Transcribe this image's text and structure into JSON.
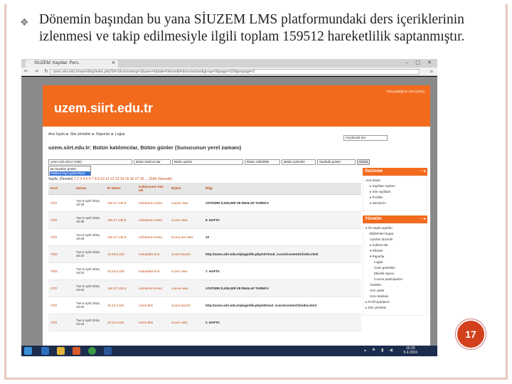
{
  "slide": {
    "bullet_icon": "diamond-bullet",
    "text": "Dönemin başından bu yana SİUZEM LMS platformundaki ders içeriklerinin izlenmesi ve takip edilmesiyle ilgili toplam 159512 hareketlilik saptanmıştır.",
    "page_number": "17"
  },
  "browser": {
    "tab_title": "SİUZEM: Kayıtlar: Pers..",
    "url": "uzem.siirt.edu.tr/report/log/index.php?id=1&chooselog=1&user=0&date=0&modid=&modaction&group=0&page=100&perpage=3",
    "nav_glyphs": "← → ↻",
    "window_controls": "– □ ✕"
  },
  "site": {
    "title": "uzem.siirt.edu.tr",
    "login_info": "Giriş yaptığınız isim (Çıkış)",
    "breadcrumb": "Ana Sayfa ► Site yönetimi ► Raporlar ► Loglar",
    "search_placeholder": "Kayıtlarda ara",
    "heading": "uzem.siirt.edu.tr: Bütün katılımcılar, Bütün günler (Sunucunun yerel zamanı)",
    "filters": {
      "course": "uzem.siirt.edu.tr (Site)",
      "participants": "Bütün katılımcılar",
      "day": "Bütün günler",
      "activities": "Bütün etkinlikler",
      "actions": "Bütün eylemler",
      "display": "Sayfada göster",
      "submit": "Gözat"
    },
    "dropdown_options": [
      "Bu kayıtları göster",
      "159512 kayıt gösteriliyor"
    ],
    "pager": {
      "prefix": "Sayfa: (Önceki)",
      "pages": "1 2 3 4 5 6 7 8 9 10 11 12 13 14 15 16 17 18 ... 1596",
      "next": "(Sonraki)"
    },
    "table": {
      "headers": [
        "Kurs",
        "Zaman",
        "IP adresi",
        "Kullanıcının tam adı",
        "Eylem",
        "Bilgi"
      ],
      "rows": [
        [
          "ATİ2",
          "Tue 5 April 2016, 15:35",
          "194.27.145.9",
          "muharrem ersan",
          "course view",
          "ATATÜRK İLKELERİ VE İNKILAP TARİHİ II"
        ],
        [
          "ATİ2",
          "Tue 5 April 2016, 15:35",
          "194.27.145.9",
          "muharrem ersan",
          "scorm view",
          "9. HAFTA"
        ],
        [
          "ATİ2",
          "Tue 5 April 2016, 15:35",
          "194.27.145.9",
          "muharrem ersan",
          "scorm pre-view",
          "10"
        ],
        [
          "TDİ2",
          "Tue 5 April 2016, 15:34",
          "10.45.0.220",
          "mukaddes kurt",
          "scorm launch",
          "http://uzem.siirt.edu.tr/pluginfile.php/157/mod_scorm/content/1/index.html"
        ],
        [
          "TDİ2",
          "Tue 5 April 2016, 15:34",
          "10.45.0.220",
          "mukaddes kurt",
          "scorm view",
          "7. HAFTA"
        ],
        [
          "ATİ2",
          "Tue 5 April 2016, 15:34",
          "194.27.145.9",
          "muharrem ersan",
          "course view",
          "ATATÜRK İLKELERİ VE İNKILAP TARİHİ II"
        ],
        [
          "ATİ2",
          "Tue 5 April 2016, 15:34",
          "10.41.0.191",
          "ceren ilkin",
          "scorm launch",
          "http://uzem.siirt.edu.tr/pluginfile.php/43/mod_scorm/content/1/index.html"
        ],
        [
          "ATİ2",
          "Tue 5 April 2016, 15:34",
          "10.41.0.191",
          "ceren ilkin",
          "scorm view",
          "2. HAFTA"
        ]
      ]
    },
    "sidebar": {
      "nav_title": "Gezinme",
      "nav_items": [
        {
          "label": "Ana Sayfa",
          "level": 1
        },
        {
          "label": "▸ Sayfalar sayfam",
          "level": 2
        },
        {
          "label": "▸ Site sayfaları",
          "level": 2
        },
        {
          "label": "▸ Profilim",
          "level": 2
        },
        {
          "label": "▸ Derslerim",
          "level": 2
        }
      ],
      "admin_title": "Yönetim",
      "admin_items": [
        {
          "label": "▾ Ön sayfa ayarları",
          "level": 1
        },
        {
          "label": "Bildirimleri kapat",
          "level": 2
        },
        {
          "label": "Ayarları düzenle",
          "level": 2
        },
        {
          "label": "▸ Kullanıcılar",
          "level": 2
        },
        {
          "label": "▾ Filtreler",
          "level": 2
        },
        {
          "label": "▾ Raporlar",
          "level": 2
        },
        {
          "label": "Loglar",
          "level": 3
        },
        {
          "label": "Canlı günlükler",
          "level": 3
        },
        {
          "label": "Etkinlik raporu",
          "level": 3
        },
        {
          "label": "Course participation",
          "level": 3
        },
        {
          "label": "Yedekle",
          "level": 2
        },
        {
          "label": "Geri yükle",
          "level": 2
        },
        {
          "label": "Soru bankası",
          "level": 2
        },
        {
          "label": "▸ Profil ayarlarım",
          "level": 1
        },
        {
          "label": "▸ Site yönetimi",
          "level": 1
        }
      ]
    }
  },
  "taskbar": {
    "clock_time": "15:33",
    "clock_date": "5.4.2016",
    "tray": "▴ ⚑ ▮ ◀"
  },
  "colors": {
    "brand_orange": "#f26b1d",
    "link": "#c24b11",
    "page_number_bg": "#d2401c",
    "frame": "#e9c7bd"
  }
}
